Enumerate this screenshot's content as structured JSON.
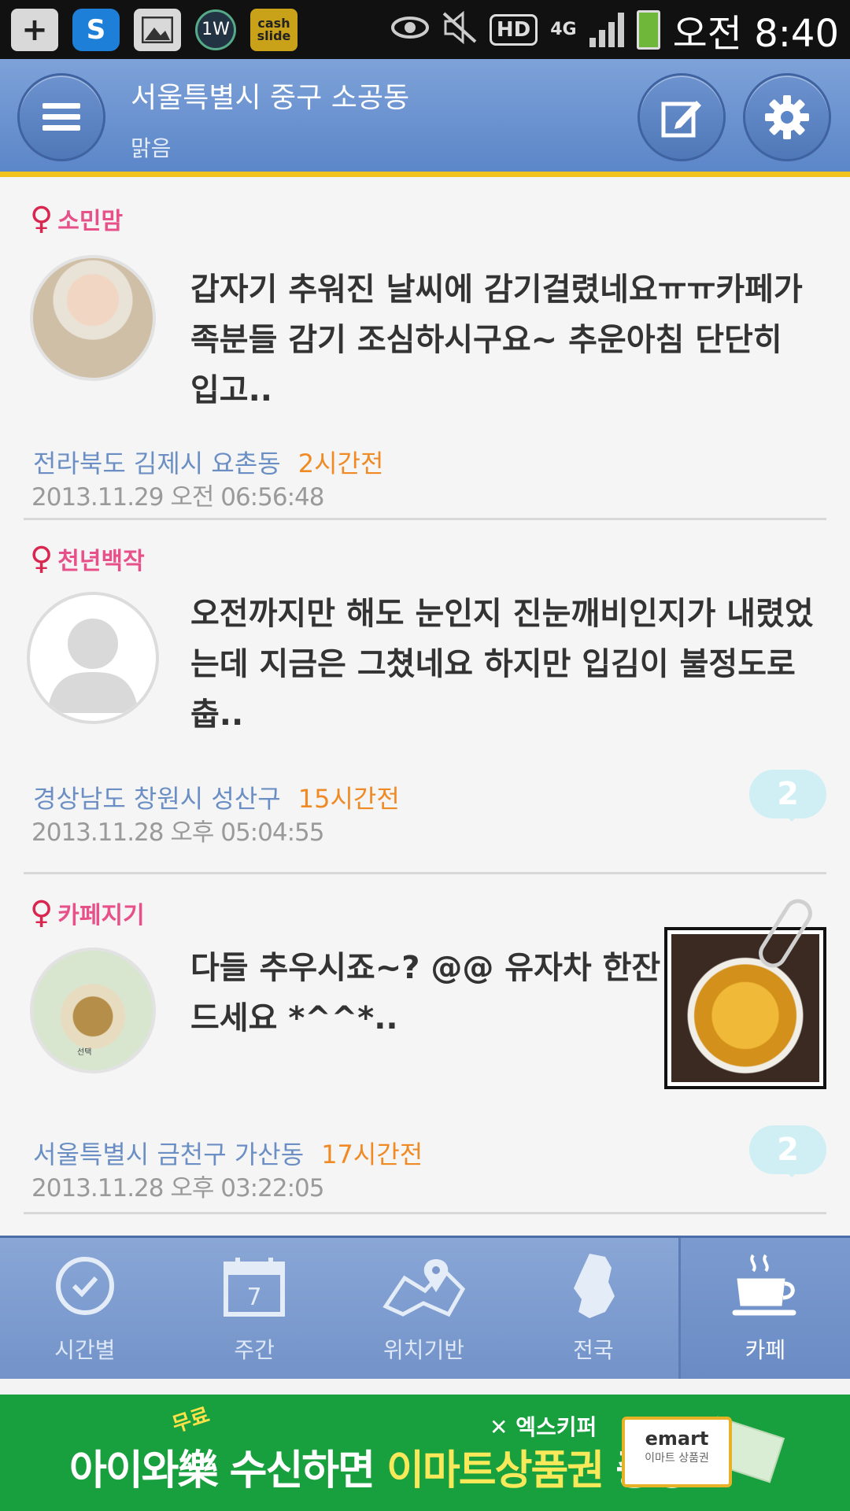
{
  "status_bar": {
    "icons": [
      "plus-icon",
      "s-app-icon",
      "gallery-icon",
      "1w-app-icon",
      "cash-slide-icon"
    ],
    "cash_slide_label": "cash\nslide",
    "app_1w_label": "1W",
    "hd_label": "HD",
    "network_label": "4G",
    "time": "오전 8:40"
  },
  "header": {
    "location": "서울특별시 중구 소공동",
    "weather": "맑음"
  },
  "posts": [
    {
      "author": "소민맘",
      "gender": "♀",
      "text": "갑자기 추워진 날씨에 감기걸렸네요ㅠㅠ카페가족분들 감기 조심하시구요~ 추운아침 단단히 입고..",
      "location": "전라북도 김제시 요촌동",
      "ago": "2시간전",
      "timestamp": "2013.11.29 오전 06:56:48",
      "comments": ""
    },
    {
      "author": "천년백작",
      "gender": "♀",
      "text": "오전까지만 해도 눈인지 진눈깨비인지가 내렸었는데 지금은 그쳤네요 하지만 입김이 불정도로 춥..",
      "location": "경상남도 창원시 성산구",
      "ago": "15시간전",
      "timestamp": "2013.11.28 오후 05:04:55",
      "comments": "2"
    },
    {
      "author": "카페지기",
      "gender": "♀",
      "text": "다들 추우시죠~? @@ 유자차 한잔드세요 *^^*..",
      "location": "서울특별시 금천구 가산동",
      "ago": "17시간전",
      "timestamp": "2013.11.28 오후 03:22:05",
      "comments": "2",
      "avatar_caption": "선택"
    }
  ],
  "bottom_nav": [
    {
      "label": "시간별",
      "icon": "clock-icon"
    },
    {
      "label": "주간",
      "icon": "calendar-icon",
      "day": "7"
    },
    {
      "label": "위치기반",
      "icon": "map-pin-icon"
    },
    {
      "label": "전국",
      "icon": "korea-map-icon"
    },
    {
      "label": "카페",
      "icon": "coffee-cup-icon",
      "active": true
    }
  ],
  "ad": {
    "badge": "무료",
    "sponsor": "엑스키퍼",
    "text_part1": "아이와樂 수신하면 ",
    "text_highlight": "이마트상품권",
    "text_part2": " 증정!",
    "voucher_brand": "emart",
    "voucher_caption": "이마트 상품권"
  },
  "colors": {
    "header": "#5b86c8",
    "accent_line": "#f2c21d",
    "author": "#e8508a",
    "location": "#6b8fc4",
    "ago": "#ef8a25",
    "ad_bg": "#18a03e"
  }
}
